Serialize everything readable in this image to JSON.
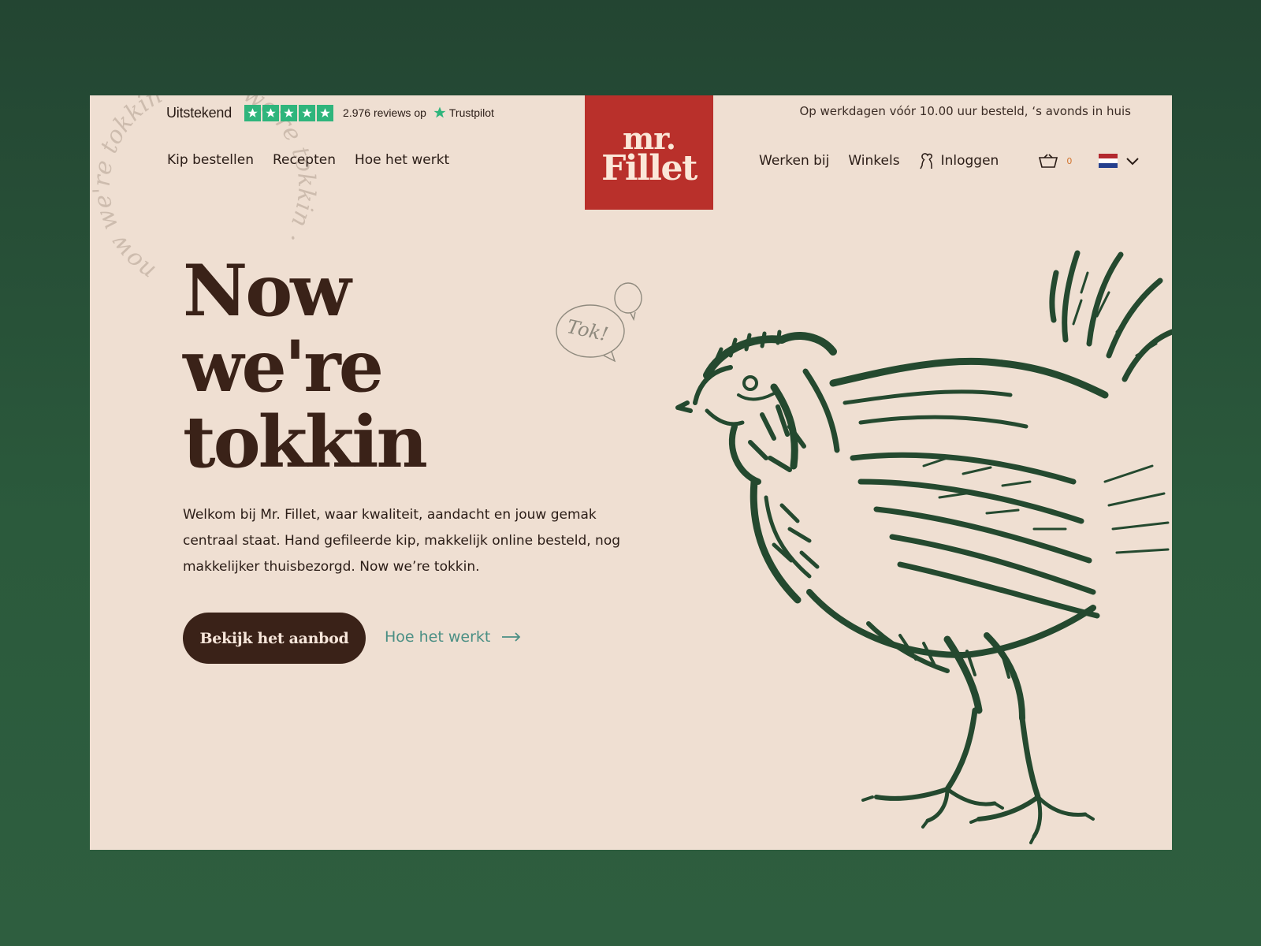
{
  "trustpilot": {
    "rating_label": "Uitstekend",
    "stars": 5,
    "reviews_text": "2.976 reviews op",
    "brand": "Trustpilot",
    "star_color": "#2fb57c"
  },
  "delivery_note": "Op werkdagen vóór 10.00 uur besteld, ‘s avonds in huis",
  "logo": {
    "line1": "mr.",
    "line2": "Fillet",
    "background": "#b9302b"
  },
  "nav_left": [
    "Kip bestellen",
    "Recepten",
    "Hoe het werkt"
  ],
  "nav_right": {
    "items": [
      "Werken bij",
      "Winkels"
    ],
    "login_label": "Inloggen",
    "cart_count": "0",
    "language_flag": "nl-flag-icon"
  },
  "stamp_text": "now we're tokkin · now we're tokkin ·",
  "bubble_text": "Tok!",
  "hero": {
    "title_lines": [
      "Now",
      "we're",
      "tokkin"
    ],
    "text": "Welkom bij Mr. Fillet, waar kwaliteit, aandacht en jouw gemak centraal staat. Hand gefileerde kip, makkelijk online besteld, nog makkelijker thuisbezorgd. Now we’re tokkin.",
    "cta_label": "Bekijk het aanbod",
    "secondary_label": "Hoe het werkt"
  },
  "colors": {
    "page_bg": "#efdfd2",
    "dark_brown": "#3a2218",
    "teal_link": "#4a8f84",
    "illustration_green": "#24492f"
  }
}
